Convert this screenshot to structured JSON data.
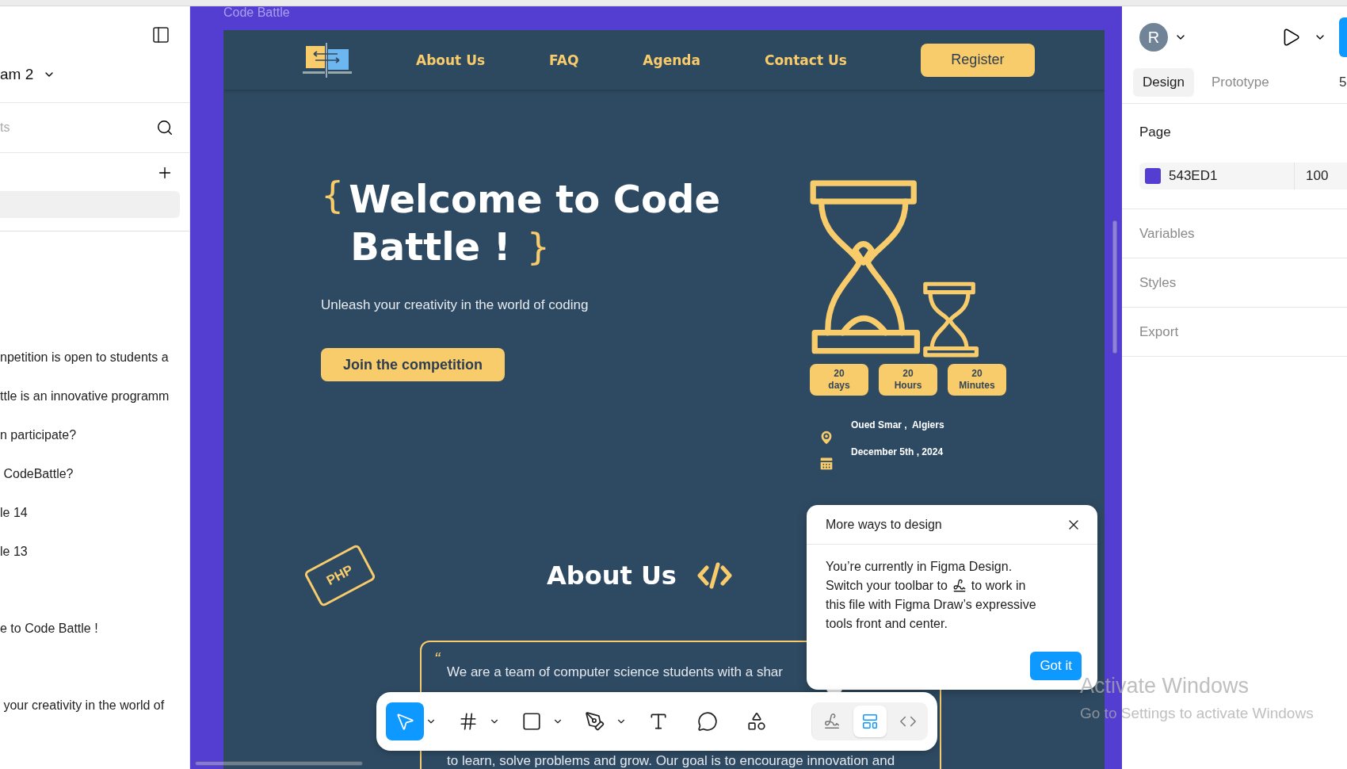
{
  "left_panel": {
    "file_name": "am 2",
    "search": {
      "placeholder": "ts"
    },
    "layers": [
      "npetition is open to students a",
      "ttle is an innovative programm",
      "n participate?",
      " CodeBattle?",
      "le 14",
      "le 13",
      "e to Code Battle !",
      " your creativity in the world of"
    ]
  },
  "canvas": {
    "frame_label": "Code Battle",
    "nav": {
      "links": [
        "About Us",
        "FAQ",
        "Agenda",
        "Contact Us"
      ],
      "register": "Register"
    },
    "hero": {
      "open_brace": "{",
      "close_brace": "}",
      "title_lines": [
        "Welcome to Code",
        "Battle !"
      ],
      "subtitle": "Unleash your creativity in the world of coding",
      "cta": "Join the competition",
      "countdown": [
        {
          "value": "20",
          "unit": "days"
        },
        {
          "value": "20",
          "unit": "Hours"
        },
        {
          "value": "20",
          "unit": "Minutes"
        }
      ],
      "location": "Oued Smar ,  Algiers",
      "date": "December 5th , 2024"
    },
    "about": {
      "php_badge": "PHP",
      "heading": "About Us",
      "quote_mark": "“",
      "quote_lines": [
        "We are a team of computer science students with a shar",
        "to learn, solve problems and grow. Our goal is to encourage innovation and"
      ]
    }
  },
  "toolbar": {
    "tools": [
      {
        "kind": "move",
        "selected": true,
        "menu": true
      },
      {
        "kind": "frame",
        "selected": false,
        "menu": true
      },
      {
        "kind": "shape",
        "selected": false,
        "menu": true
      },
      {
        "kind": "pen",
        "selected": false,
        "menu": true
      },
      {
        "kind": "text",
        "selected": false,
        "menu": false
      },
      {
        "kind": "comment",
        "selected": false,
        "menu": false
      },
      {
        "kind": "actions",
        "selected": false,
        "menu": false
      }
    ],
    "modes": [
      {
        "kind": "draw",
        "selected": false
      },
      {
        "kind": "design",
        "selected": true
      },
      {
        "kind": "dev",
        "selected": false
      }
    ]
  },
  "popup": {
    "title": "More ways to design",
    "body_lines": [
      [
        "You’re currently in Figma Design."
      ],
      [
        "Switch your toolbar to",
        "to work in"
      ],
      [
        "this file with Figma Draw’s expressive"
      ],
      [
        "tools front and center."
      ]
    ],
    "button": "Got it"
  },
  "right_panel": {
    "avatar": "R",
    "tabs": [
      {
        "label": "Design",
        "selected": true
      },
      {
        "label": "Prototype",
        "selected": false
      }
    ],
    "zoom_label": "5",
    "page_heading": "Page",
    "page_color": {
      "hex": "543ED1",
      "opacity": "100",
      "color": "#543ed1"
    },
    "sections": [
      "Variables",
      "Styles",
      "Export"
    ]
  },
  "os_notice": {
    "title": "Activate Windows",
    "subtitle": "Go to Settings to activate Windows"
  }
}
